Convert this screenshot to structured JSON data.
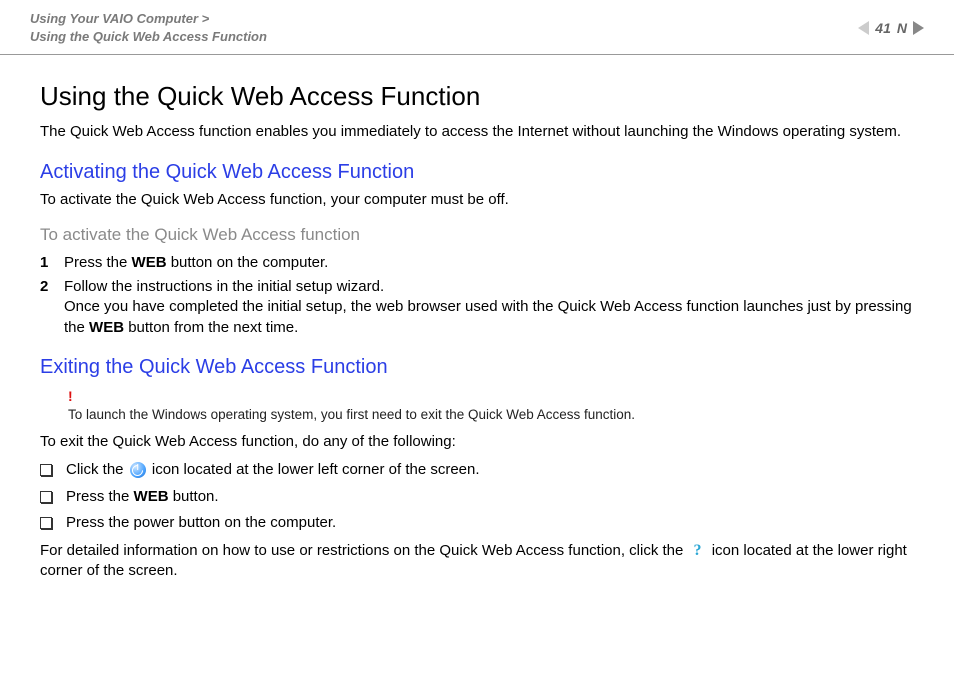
{
  "header": {
    "breadcrumb_line1": "Using Your VAIO Computer >",
    "breadcrumb_line2": "Using the Quick Web Access Function",
    "page_number": "41",
    "nav_char": "N"
  },
  "h1": "Using the Quick Web Access Function",
  "intro": "The Quick Web Access function enables you immediately to access the Internet without launching the Windows operating system.",
  "sec1": {
    "heading": "Activating the Quick Web Access Function",
    "para": "To activate the Quick Web Access function, your computer must be off.",
    "subheading": "To activate the Quick Web Access function",
    "steps": {
      "s1_num": "1",
      "s1_a": "Press the ",
      "s1_web": "WEB",
      "s1_b": " button on the computer.",
      "s2_num": "2",
      "s2_a": "Follow the instructions in the initial setup wizard.",
      "s2_b_a": "Once you have completed the initial setup, the web browser used with the Quick Web Access function launches just by pressing the ",
      "s2_b_web": "WEB",
      "s2_b_b": " button from the next time."
    }
  },
  "sec2": {
    "heading": "Exiting the Quick Web Access Function",
    "note_bang": "!",
    "note_text": "To launch the Windows operating system, you first need to exit the Quick Web Access function.",
    "para": "To exit the Quick Web Access function, do any of the following:",
    "b1_a": "Click the ",
    "b1_b": " icon located at the lower left corner of the screen.",
    "b2_a": "Press the ",
    "b2_web": "WEB",
    "b2_b": " button.",
    "b3": "Press the power button on the computer.",
    "tail_a": "For detailed information on how to use or restrictions on the Quick Web Access function, click the ",
    "tail_b": " icon located at the lower right corner of the screen."
  }
}
